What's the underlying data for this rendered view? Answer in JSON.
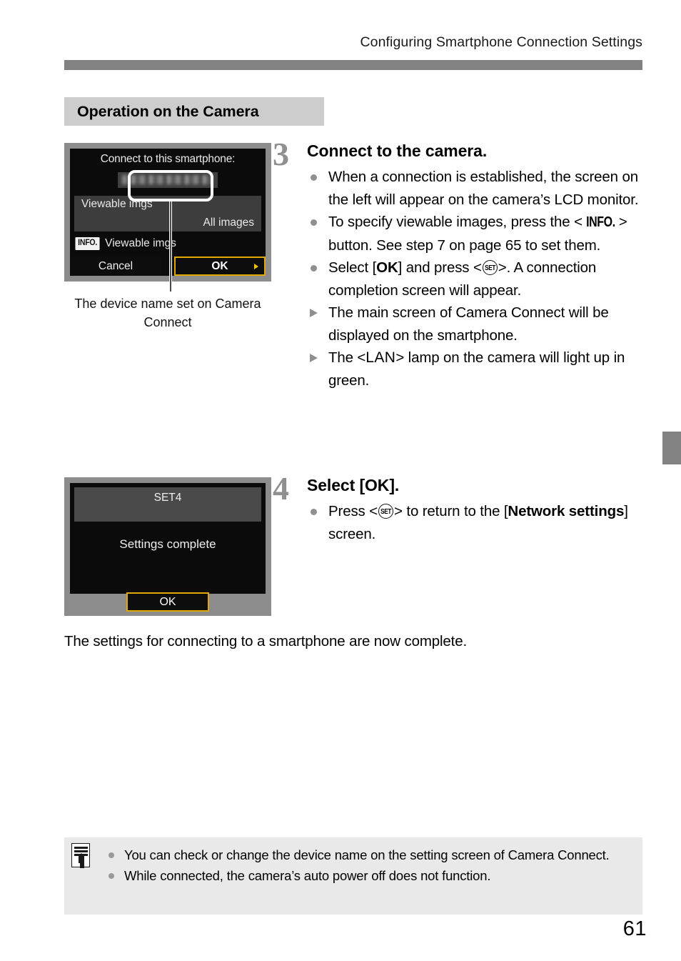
{
  "header": {
    "running_head": "Configuring Smartphone Connection Settings"
  },
  "section": {
    "title": "Operation on the Camera"
  },
  "figures": [
    {
      "name": "connect-to-smartphone-screen",
      "title": "Connect to this smartphone:",
      "device_name_value": "",
      "rows": [
        {
          "label": "Viewable imgs",
          "value": "All images"
        }
      ],
      "info_badge": "INFO.",
      "info_hint": "Viewable imgs",
      "buttons": [
        {
          "label": "Cancel",
          "highlighted": false
        },
        {
          "label": "OK",
          "highlighted": true
        }
      ],
      "caption": "The device name set on Camera Connect"
    },
    {
      "name": "settings-complete-screen",
      "set_name": "SET4",
      "message": "Settings complete",
      "buttons": [
        {
          "label": "OK",
          "highlighted": true
        }
      ]
    }
  ],
  "steps": [
    {
      "number": "3",
      "heading": "Connect to the camera.",
      "items": [
        {
          "kind": "dot",
          "parts": [
            {
              "t": "text",
              "v": "When a connection is established, the screen on the left will appear on the camera’s LCD monitor."
            }
          ]
        },
        {
          "kind": "dot",
          "parts": [
            {
              "t": "text",
              "v": "To specify viewable images, press the <"
            },
            {
              "t": "info",
              "v": "INFO."
            },
            {
              "t": "text",
              "v": "> button. See step 7 on page 65 to set them."
            }
          ]
        },
        {
          "kind": "dot",
          "parts": [
            {
              "t": "text",
              "v": "Select ["
            },
            {
              "t": "bold",
              "v": "OK"
            },
            {
              "t": "text",
              "v": "] and press <"
            },
            {
              "t": "set",
              "v": "SET"
            },
            {
              "t": "text",
              "v": ">. A connection completion screen will appear."
            }
          ]
        },
        {
          "kind": "arrow",
          "parts": [
            {
              "t": "text",
              "v": "The main screen of Camera Connect will be displayed on the smartphone."
            }
          ]
        },
        {
          "kind": "arrow",
          "parts": [
            {
              "t": "text",
              "v": "The <"
            },
            {
              "t": "lan",
              "v": "LAN"
            },
            {
              "t": "text",
              "v": "> lamp on the camera will light up in green."
            }
          ]
        }
      ]
    },
    {
      "number": "4",
      "heading": "Select [OK].",
      "items": [
        {
          "kind": "dot",
          "parts": [
            {
              "t": "text",
              "v": "Press <"
            },
            {
              "t": "set",
              "v": "SET"
            },
            {
              "t": "text",
              "v": "> to return to the ["
            },
            {
              "t": "bold",
              "v": "Network settings"
            },
            {
              "t": "text",
              "v": "] screen."
            }
          ]
        }
      ]
    }
  ],
  "closing_paragraph": "The settings for connecting to a smartphone are now complete.",
  "note": {
    "icon": "note-pencil-icon",
    "items": [
      "You can check or change the device name on the setting screen of Camera Connect.",
      "While connected, the camera’s auto power off does not function."
    ]
  },
  "folio": {
    "page_number": "61"
  },
  "colors": {
    "header_rule": "#828282",
    "section_band": "#cdcdcd",
    "step_number": "#8f8f8f",
    "lcd_bezel": "#8c8c8c",
    "lcd_background": "#0b0b0b",
    "highlight_border": "#e0a900",
    "note_background": "#e9e9e9"
  }
}
